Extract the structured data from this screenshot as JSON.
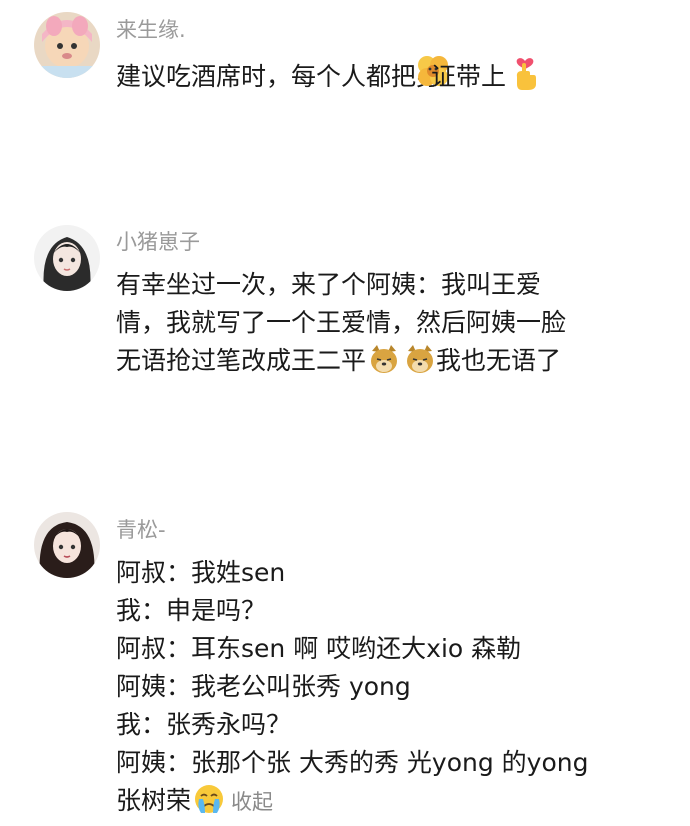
{
  "comments": [
    {
      "username": "来生缘.",
      "lines": [
        {
          "text_before": "建议吃酒席时，每个人都把身",
          "text_after": "证带上"
        }
      ]
    },
    {
      "username": "小猪崽子",
      "lines": [
        {
          "text": "有幸坐过一次，来了个阿姨：我叫王爱"
        },
        {
          "text": "情，我就写了一个王爱情，然后阿姨一脸"
        },
        {
          "text_before": "无语抢过笔改成王二平",
          "text_after": "我也无语了"
        }
      ]
    },
    {
      "username": "青松-",
      "lines": [
        {
          "text": "阿叔：我姓sen"
        },
        {
          "text": "我：申是吗？"
        },
        {
          "text": "阿叔：耳东sen 啊  哎哟还大xio 森勒"
        },
        {
          "text": " 阿姨：我老公叫张秀 yong"
        },
        {
          "text": "我：张秀永吗？"
        },
        {
          "text": "阿姨：张那个张 大秀的秀 光yong 的yong"
        },
        {
          "text_before": "张树荣",
          "text_after": ""
        }
      ],
      "collapse_label": "收起"
    }
  ],
  "icons": {
    "comment1_emoji_flower": "flower-sticker-icon",
    "comment1_emoji_heart": "finger-heart-icon",
    "comment2_emoji_doge": "doge-icon",
    "comment3_emoji_cry": "crying-face-icon"
  }
}
